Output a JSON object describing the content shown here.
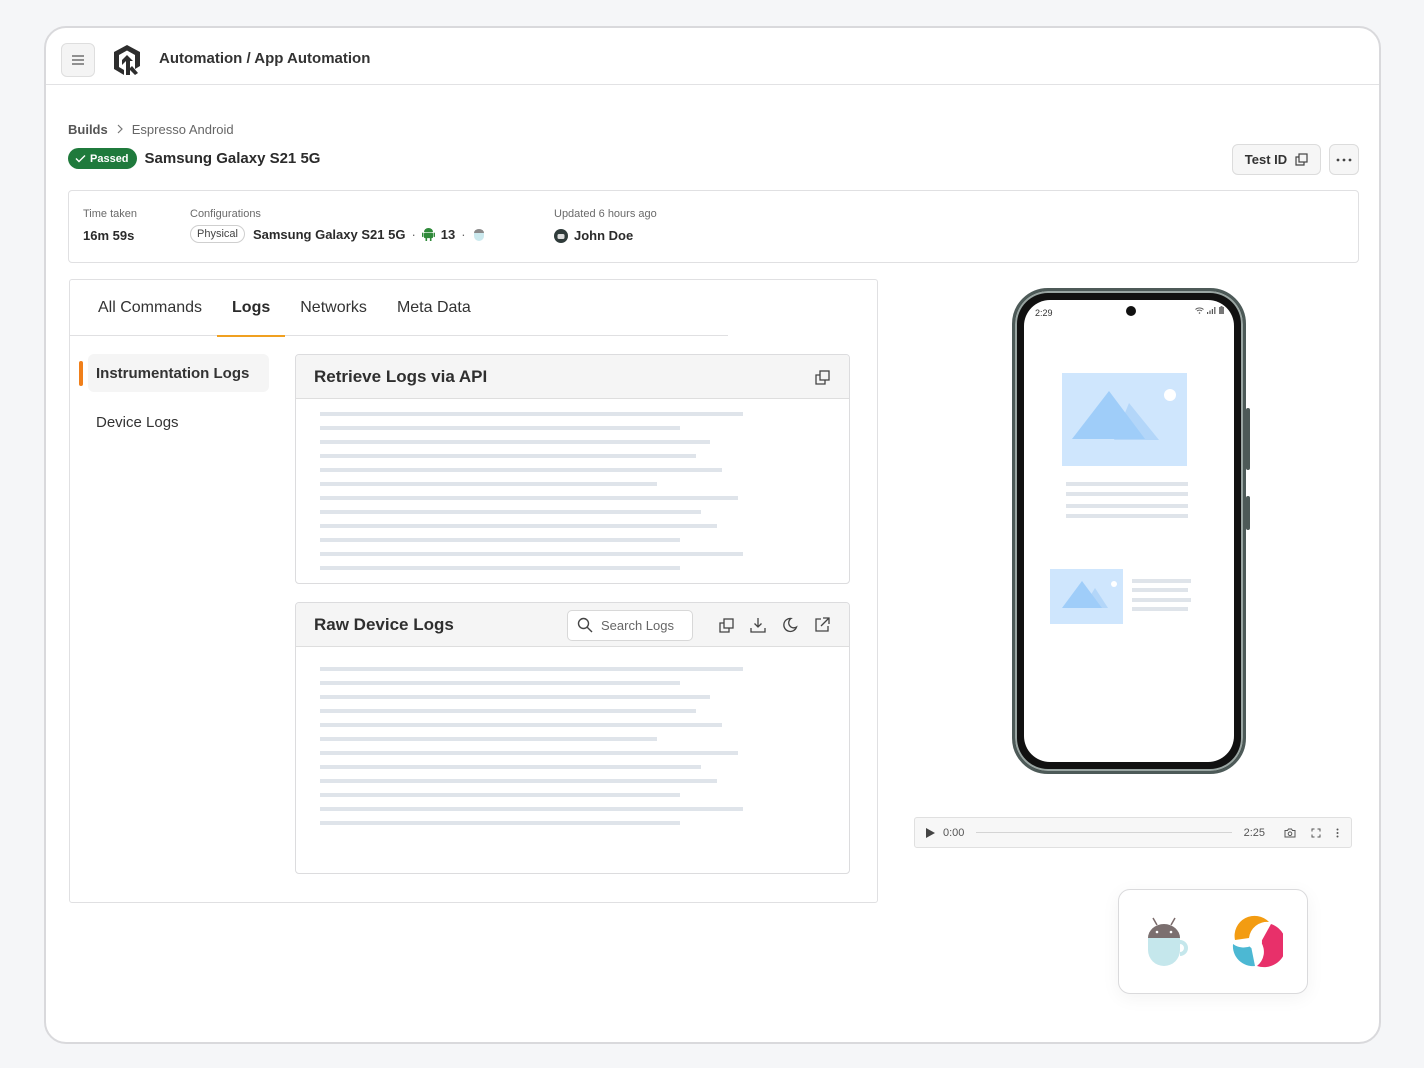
{
  "header": {
    "app_title": "Automation / App Automation",
    "menu_icon": "hamburger-menu-icon",
    "logo_icon": "lambdatest-logo-icon"
  },
  "breadcrumb": {
    "items": [
      "Builds",
      "Espresso Android"
    ],
    "separator_icon": "chevron-right-icon"
  },
  "test": {
    "status": "Passed",
    "status_color": "#1f7a3c",
    "title": "Samsung Galaxy S21 5G",
    "test_id_label": "Test ID",
    "more_icon": "ellipsis-icon"
  },
  "info": {
    "time_taken_label": "Time taken",
    "time_taken_value": "16m 59s",
    "configurations_label": "Configurations",
    "device_type": "Physical",
    "device_name": "Samsung Galaxy S21 5G",
    "os_version": "13",
    "os_icon": "android-icon",
    "framework_icon": "espresso-icon",
    "updated_label": "Updated 6 hours ago",
    "user_name": "John Doe"
  },
  "tabs": [
    {
      "label": "All Commands",
      "active": false
    },
    {
      "label": "Logs",
      "active": true
    },
    {
      "label": "Networks",
      "active": false
    },
    {
      "label": "Meta Data",
      "active": false
    }
  ],
  "tab_accent_color": "#f0a020",
  "side_nav": [
    {
      "label": "Instrumentation Logs",
      "active": true
    },
    {
      "label": "Device Logs",
      "active": false
    }
  ],
  "panels": {
    "api": {
      "title": "Retrieve Logs via API",
      "copy_icon": "copy-icon"
    },
    "raw": {
      "title": "Raw Device Logs",
      "search_placeholder": "Search Logs",
      "tool_icons": [
        "copy-icon",
        "download-icon",
        "dark-mode-icon",
        "open-external-icon"
      ]
    }
  },
  "phone": {
    "status_time": "2:29"
  },
  "player": {
    "current_time": "0:00",
    "duration": "2:25",
    "progress_fraction": 0.0
  },
  "frameworks": [
    "espresso-icon",
    "hyperexecute-icon"
  ]
}
